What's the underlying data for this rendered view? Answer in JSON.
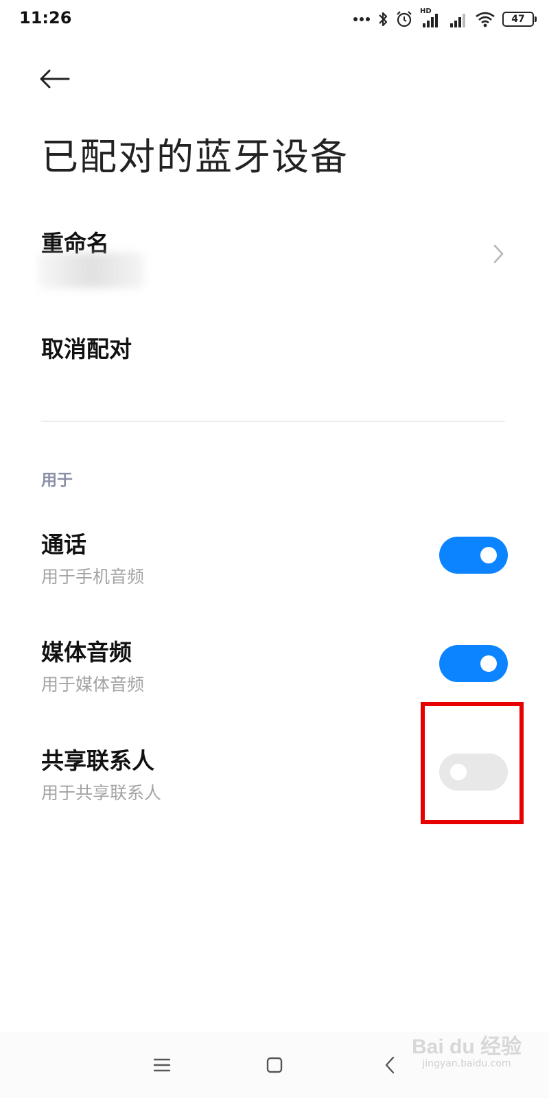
{
  "status_bar": {
    "time": "11:26",
    "network_badge": "HD",
    "battery_level": "47",
    "icons": [
      "more-dots-icon",
      "bluetooth-icon",
      "alarm-icon",
      "signal-hd-icon",
      "signal-icon",
      "wifi-icon",
      "battery-icon"
    ]
  },
  "header": {
    "back_icon": "back-arrow-icon",
    "title": "已配对的蓝牙设备"
  },
  "device": {
    "rename_label": "重命名",
    "unpair_label": "取消配对"
  },
  "section": {
    "label": "用于"
  },
  "profiles": [
    {
      "title": "通话",
      "subtitle": "用于手机音频",
      "enabled": true
    },
    {
      "title": "媒体音频",
      "subtitle": "用于媒体音频",
      "enabled": true
    },
    {
      "title": "共享联系人",
      "subtitle": "用于共享联系人",
      "enabled": false
    }
  ],
  "colors": {
    "toggle_on": "#0d84ff",
    "toggle_off": "#e8e8e8",
    "highlight": "#e60000"
  },
  "nav_bar": {
    "icons": [
      "menu-icon",
      "home-icon",
      "back-icon"
    ]
  },
  "watermark": {
    "brand": "Bai du 经验",
    "url": "jingyan.baidu.com"
  }
}
